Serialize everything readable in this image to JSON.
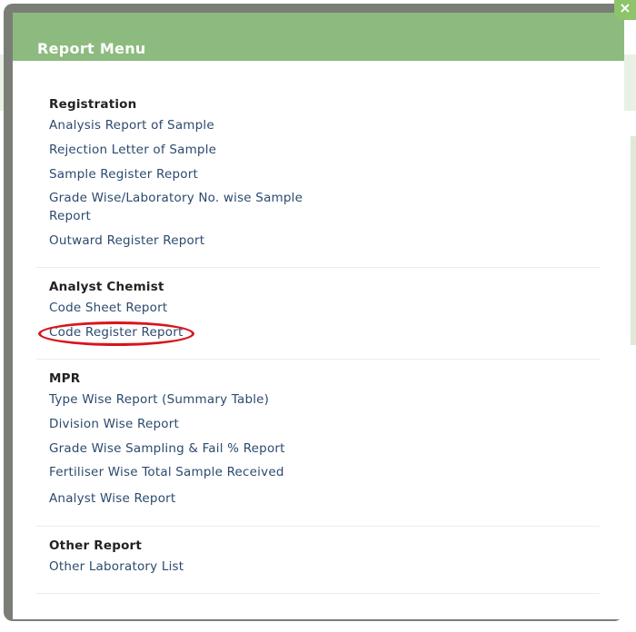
{
  "modal": {
    "title": "Report Menu",
    "close_glyph": "×"
  },
  "sections": [
    {
      "heading": "Registration",
      "items": [
        "Analysis Report of Sample",
        "Rejection Letter of Sample",
        "Sample Register Report",
        "Grade Wise/Laboratory No. wise Sample Report",
        "Outward Register Report"
      ]
    },
    {
      "heading": "Analyst Chemist",
      "items": [
        "Code Sheet Report",
        "Code Register Report"
      ]
    },
    {
      "heading": "MPR",
      "items": [
        "Type Wise Report (Summary Table)",
        "Division Wise Report",
        "Grade Wise Sampling & Fail % Report",
        "Fertiliser Wise Total Sample Received",
        "Analyst Wise Report"
      ]
    },
    {
      "heading": "Other Report",
      "items": [
        "Other Laboratory List"
      ]
    }
  ],
  "annotation": {
    "highlighted_item": "Code Register Report",
    "color": "#d8151b"
  },
  "colors": {
    "header": "#8dbb7f",
    "frame": "#7b7e76",
    "link": "#2b4a6f"
  }
}
